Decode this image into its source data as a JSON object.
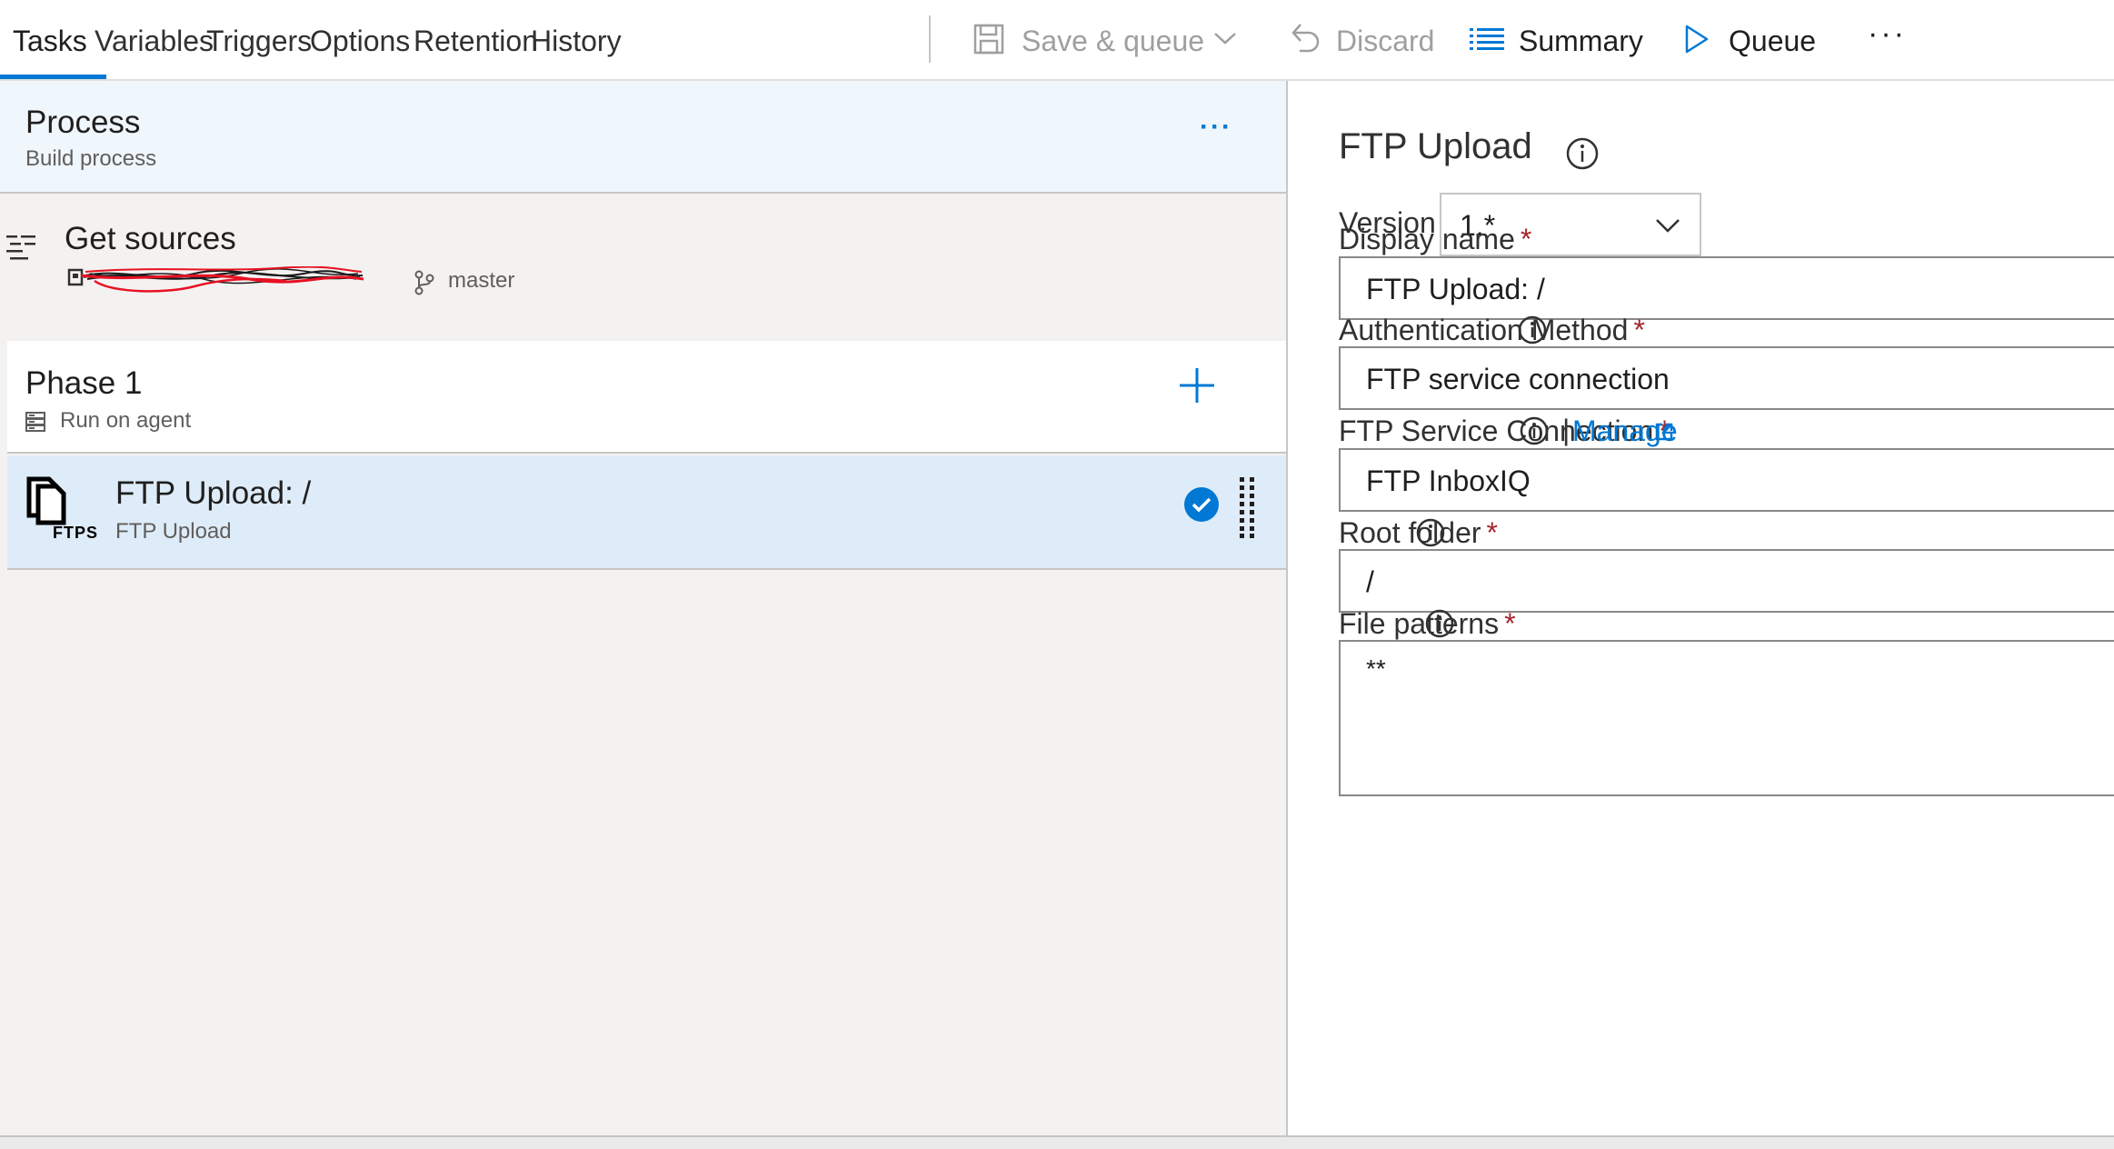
{
  "tabs": [
    {
      "label": "Tasks",
      "active": true
    },
    {
      "label": "Variables",
      "active": false
    },
    {
      "label": "Triggers",
      "active": false
    },
    {
      "label": "Options",
      "active": false
    },
    {
      "label": "Retention",
      "active": false
    },
    {
      "label": "History",
      "active": false
    }
  ],
  "toolbar": {
    "save_queue_label": "Save & queue",
    "discard_label": "Discard",
    "summary_label": "Summary",
    "queue_label": "Queue",
    "more_label": "···"
  },
  "process": {
    "title": "Process",
    "subtitle": "Build process",
    "more_label": "···"
  },
  "sources": {
    "title": "Get sources",
    "branch": "master"
  },
  "phase": {
    "title": "Phase 1",
    "subtitle": "Run on agent"
  },
  "task": {
    "title": "FTP Upload: /",
    "subtitle": "FTP Upload",
    "icon_text": "FTPS"
  },
  "details": {
    "title": "FTP Upload",
    "version_label": "Version",
    "version_value": "1.*",
    "required_mark": "*",
    "display_name": {
      "label": "Display name",
      "value": "FTP Upload: /"
    },
    "auth_method": {
      "label": "Authentication Method",
      "value": "FTP service connection"
    },
    "service_connection": {
      "label": "FTP Service Connection",
      "value": "FTP InboxIQ",
      "separator": "|",
      "manage_label": "Manage"
    },
    "root_folder": {
      "label": "Root folder",
      "value": "/"
    },
    "file_patterns": {
      "label": "File patterns",
      "value": "**"
    }
  },
  "colors": {
    "accent": "#0078d4",
    "required": "#a4262c",
    "selected_row": "#deecf9",
    "header_bg": "#eff6fc"
  }
}
